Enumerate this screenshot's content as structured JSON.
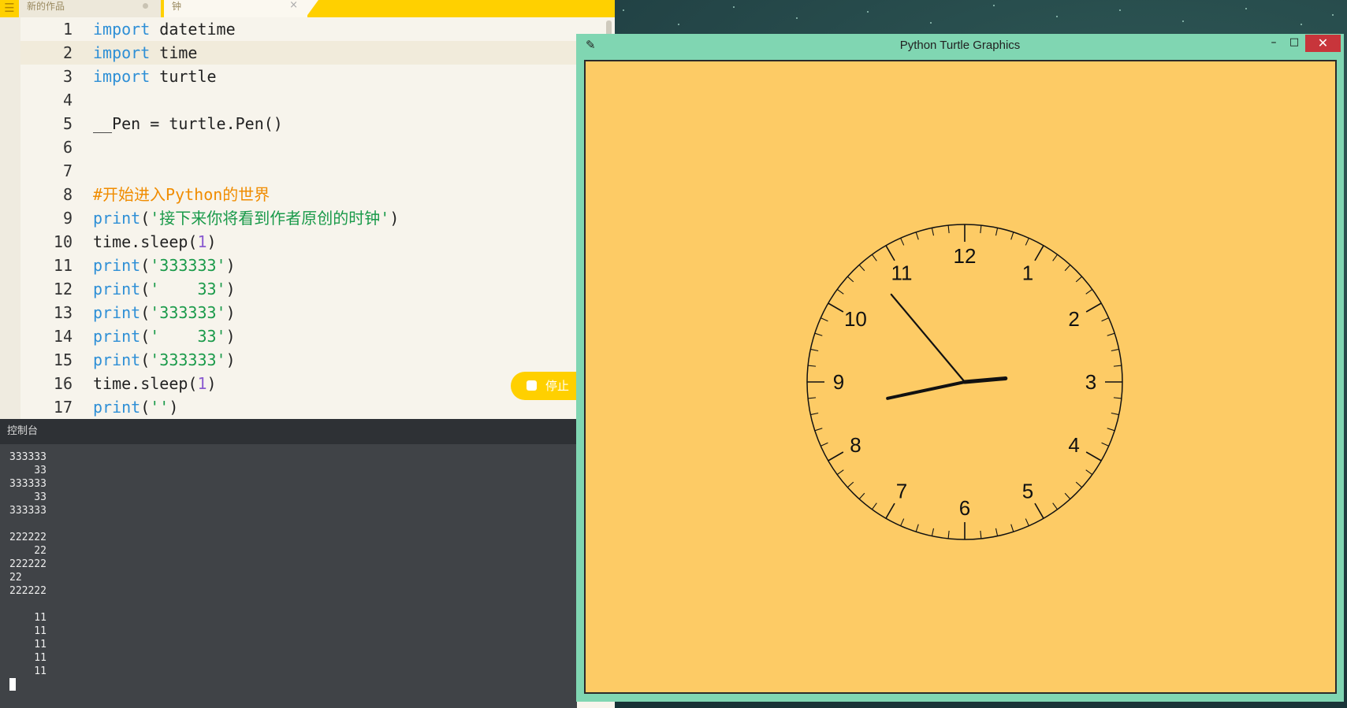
{
  "editor": {
    "tabs": [
      {
        "label": "新的作品"
      },
      {
        "label": "钟"
      }
    ],
    "tab_close_glyph": "×",
    "menu_icon": "hamburger-menu-icon",
    "code_lines": [
      {
        "n": "1",
        "tokens": [
          {
            "t": "import",
            "c": "kw"
          },
          {
            "t": " datetime",
            "c": ""
          }
        ]
      },
      {
        "n": "2",
        "tokens": [
          {
            "t": "import",
            "c": "kw"
          },
          {
            "t": " time",
            "c": ""
          }
        ]
      },
      {
        "n": "3",
        "tokens": [
          {
            "t": "import",
            "c": "kw"
          },
          {
            "t": " turtle",
            "c": ""
          }
        ]
      },
      {
        "n": "4",
        "tokens": []
      },
      {
        "n": "5",
        "tokens": [
          {
            "t": "__Pen = turtle.Pen()",
            "c": ""
          }
        ]
      },
      {
        "n": "6",
        "tokens": []
      },
      {
        "n": "7",
        "tokens": []
      },
      {
        "n": "8",
        "tokens": [
          {
            "t": "#开始进入Python的世界",
            "c": "cm"
          }
        ]
      },
      {
        "n": "9",
        "tokens": [
          {
            "t": "print",
            "c": "kw"
          },
          {
            "t": "(",
            "c": ""
          },
          {
            "t": "'接下来你将看到作者原创的时钟'",
            "c": "str"
          },
          {
            "t": ")",
            "c": ""
          }
        ]
      },
      {
        "n": "10",
        "tokens": [
          {
            "t": "time.sleep(",
            "c": ""
          },
          {
            "t": "1",
            "c": "num"
          },
          {
            "t": ")",
            "c": ""
          }
        ]
      },
      {
        "n": "11",
        "tokens": [
          {
            "t": "print",
            "c": "kw"
          },
          {
            "t": "(",
            "c": ""
          },
          {
            "t": "'333333'",
            "c": "str"
          },
          {
            "t": ")",
            "c": ""
          }
        ]
      },
      {
        "n": "12",
        "tokens": [
          {
            "t": "print",
            "c": "kw"
          },
          {
            "t": "(",
            "c": ""
          },
          {
            "t": "'    33'",
            "c": "str"
          },
          {
            "t": ")",
            "c": ""
          }
        ]
      },
      {
        "n": "13",
        "tokens": [
          {
            "t": "print",
            "c": "kw"
          },
          {
            "t": "(",
            "c": ""
          },
          {
            "t": "'333333'",
            "c": "str"
          },
          {
            "t": ")",
            "c": ""
          }
        ]
      },
      {
        "n": "14",
        "tokens": [
          {
            "t": "print",
            "c": "kw"
          },
          {
            "t": "(",
            "c": ""
          },
          {
            "t": "'    33'",
            "c": "str"
          },
          {
            "t": ")",
            "c": ""
          }
        ]
      },
      {
        "n": "15",
        "tokens": [
          {
            "t": "print",
            "c": "kw"
          },
          {
            "t": "(",
            "c": ""
          },
          {
            "t": "'333333'",
            "c": "str"
          },
          {
            "t": ")",
            "c": ""
          }
        ]
      },
      {
        "n": "16",
        "tokens": [
          {
            "t": "time.sleep(",
            "c": ""
          },
          {
            "t": "1",
            "c": "num"
          },
          {
            "t": ")",
            "c": ""
          }
        ]
      },
      {
        "n": "17",
        "tokens": [
          {
            "t": "print",
            "c": "kw"
          },
          {
            "t": "(",
            "c": ""
          },
          {
            "t": "''",
            "c": "str"
          },
          {
            "t": ")",
            "c": ""
          }
        ]
      }
    ],
    "highlighted_line": "2",
    "stop_button_label": "停止",
    "colors": {
      "accent": "#ffd000",
      "keyword": "#2e8fd6",
      "string": "#1a9a4a",
      "number": "#8a5bd0",
      "comment": "#f08c00"
    }
  },
  "console": {
    "title": "控制台",
    "lines": [
      "333333",
      "    33",
      "333333",
      "    33",
      "333333",
      "",
      "222222",
      "    22",
      "222222",
      "22",
      "222222",
      "",
      "    11",
      "    11",
      "    11",
      "    11",
      "    11"
    ]
  },
  "turtle_window": {
    "title": "Python Turtle Graphics",
    "title_icon": "feather-icon",
    "minimize_glyph": "–",
    "maximize_glyph": "□",
    "close_glyph": "✕",
    "canvas_color": "#fdcb65",
    "clock": {
      "numbers": [
        "12",
        "1",
        "2",
        "3",
        "4",
        "5",
        "6",
        "7",
        "8",
        "9",
        "10",
        "11"
      ],
      "hour_hand_angle_deg": 85,
      "minute_hand_angle_deg": 320,
      "second_hand_angle_deg": 258
    }
  }
}
